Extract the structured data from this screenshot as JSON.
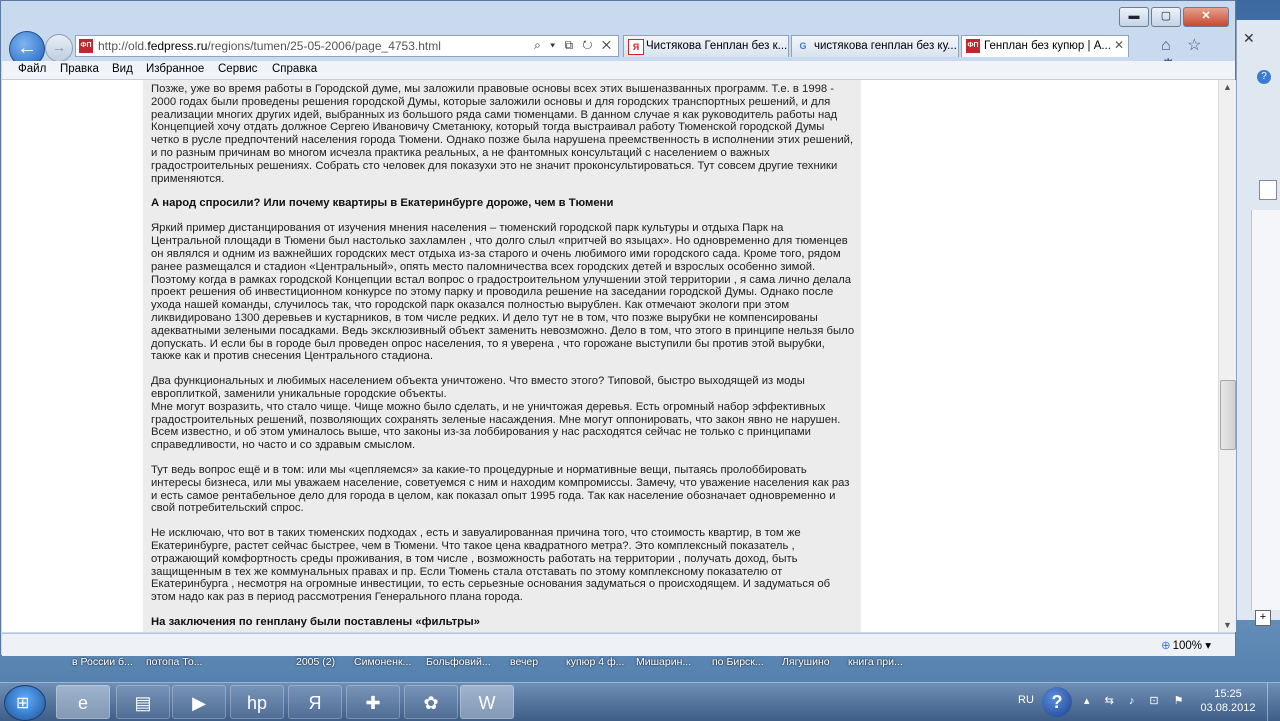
{
  "browser": {
    "address": {
      "prefix": "http://old.",
      "domain": "fedpress.ru",
      "path": "/regions/tumen/25-05-2006/page_4753.html"
    },
    "favicon_text": "ФП",
    "addr_icons": "⌕ ▾ ⧉ ↻ ✕",
    "tabs": [
      {
        "label": "Чистякова Генплан без к...",
        "icon": "Я",
        "icon_color": "#e02020"
      },
      {
        "label": "чистякова генплан без ку...",
        "icon": "G",
        "icon_color": "#3a7bd5"
      },
      {
        "label": "Генплан без купюр | А...",
        "icon": "ФП",
        "icon_color": "#c0282d"
      }
    ],
    "tab_close": "✕",
    "right_icons": "⌂ ☆ ⚙",
    "window_buttons": {
      "minimize": "▬",
      "maximize": "▢",
      "close": "✕"
    }
  },
  "menu": [
    "Файл",
    "Правка",
    "Вид",
    "Избранное",
    "Сервис",
    "Справка"
  ],
  "article": {
    "p1": "Позже, уже во время работы в Городской думе, мы заложили правовые основы всех этих вышеназванных программ. Т.е. в 1998 - 2000 годах были проведены решения городской Думы, которые заложили основы и для городских транспортных решений, и для реализации многих других идей, выбранных из большого ряда сами тюменцами. В данном случае я как руководитель работы над Концепцией хочу отдать должное Сергею Ивановичу Сметанюку, который тогда выстраивал работу Тюменской городской Думы четко в русле предпочтений населения города Тюмени. Однако позже была нарушена преемственность в исполнении этих решений, и по разным причинам во многом исчезла практика реальных, а не фантомных консультаций с населением о важных градостроительных решениях. Собрать сто человек для показухи это не значит проконсультироваться. Тут совсем другие техники применяются.",
    "h1": "А народ спросили? Или почему квартиры в Екатеринбурге дороже, чем в Тюмени",
    "p2": "Яркий пример дистанцирования от изучения мнения населения – тюменский городской парк культуры и отдыха Парк на Центральной площади в Тюмени был настолько захламлен , что долго слыл «притчей во языцах». Но одновременно для тюменцев он являлся и одним из важнейших городских мест отдыха из-за старого и очень любимого ими городского сада. Кроме того, рядом ранее размещался и стадион «Центральный», опять место паломничества всех городских детей и взрослых особенно зимой. Поэтому когда в рамках городской Концепции встал вопрос о градостроительном улучшении этой территории , я сама лично делала проект решения об инвестиционном конкурсе по этому парку и проводила решение на заседании городской Думы. Однако после ухода нашей команды, случилось так, что городской парк оказался полностью вырублен. Как отмечают экологи при этом ликвидировано 1300 деревьев и кустарников, в том числе редких. И дело тут не в том, что позже вырубки не компенсированы адекватными зелеными посадками. Ведь эксклюзивный объект заменить невозможно. Дело в том, что этого в принципе нельзя было допускать. И если бы в городе был проведен опрос населения, то я уверена , что горожане выступили бы против этой вырубки, также как и против снесения Центрального стадиона.",
    "p3a": "Два функциональных и любимых населением объекта уничтожено. Что вместо этого? Типовой, быстро выходящей из моды европлиткой, заменили уникальные городские объекты.",
    "p3b": "Мне могут возразить, что стало чище. Чище можно было сделать, и не уничтожая деревья. Есть огромный набор эффективных градостроительных решений, позволяющих сохранять зеленые насаждения. Мне могут оппонировать, что закон явно не нарушен. Всем известно, и об этом уминалось выше, что законы из-за лоббирования у нас расходятся сейчас не только с принципами справедливости, но часто и со здравым смыслом.",
    "p4": "Тут ведь вопрос ещё и в том: или мы «цепляемся» за какие-то процедурные и нормативные вещи, пытаясь пролоббировать интересы бизнеса, или мы уважаем население, советуемся с ним и находим компромиссы. Замечу, что уважение населения как раз и есть самое рентабельное дело для города в целом, как показал опыт 1995 года. Так как население обозначает одновременно и свой потребительский спрос.",
    "p5": "Не исключаю, что вот в таких тюменских подходах , есть и завуалированная причина того, что стоимость квартир, в том же Екатеринбурге, растет сейчас быстрее, чем в Тюмени. Что такое цена квадратного метра?. Это комплексный показатель , отражающий комфортность среды проживания, в том числе , возможность работать на территории , получать доход, быть защищенным в тех же коммунальных правах и пр. Если Тюмень стала отставать по этому комплексному показателю от Екатеринбурга , несмотря на огромные инвестиции, то есть серьезные основания задуматься о происходящем. И задуматься об этом надо как раз в период рассмотрения Генерального плана города.",
    "h2": "На заключения по генплану были поставлены «фильтры»"
  },
  "status": {
    "zoom": "100%",
    "zoom_arrow": "▾"
  },
  "task_labels": [
    "в России б...",
    "потопа То...",
    "2005 (2)",
    "Симоненк...",
    "Больфовий...",
    "вечер",
    "купюр 4 ф...",
    "Мишарин...",
    "по Бирск...",
    "Лягушино",
    "книга при..."
  ],
  "taskbar": {
    "apps": [
      {
        "name": "ie",
        "glyph": "e"
      },
      {
        "name": "explorer",
        "glyph": "▤"
      },
      {
        "name": "media",
        "glyph": "▶"
      },
      {
        "name": "hp",
        "glyph": "hp"
      },
      {
        "name": "yandex",
        "glyph": "Я"
      },
      {
        "name": "app6",
        "glyph": "✚"
      },
      {
        "name": "app7",
        "glyph": "✿"
      },
      {
        "name": "word",
        "glyph": "W"
      }
    ],
    "lang": "RU",
    "help": "?",
    "sys_icons": "▴ ⇆ ♪ ⊡ ⚑",
    "time": "15:25",
    "date": "03.08.2012"
  },
  "colors": {
    "article_bg": "#ececec",
    "accent": "#3a7bd5",
    "fp_red": "#c0282d"
  }
}
